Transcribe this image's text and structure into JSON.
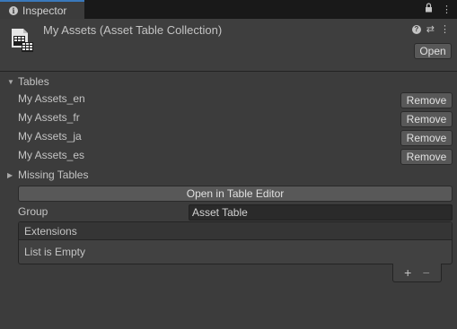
{
  "tab": {
    "title": "Inspector",
    "info_icon": "i",
    "lock_icon": "lock",
    "menu_icon": "⋮"
  },
  "header": {
    "title": "My Assets (Asset Table Collection)",
    "help_icon": "?",
    "presets_icon": "⇄",
    "menu_icon": "⋮",
    "open_label": "Open"
  },
  "tables": {
    "label": "Tables",
    "items": [
      {
        "name": "My Assets_en",
        "action": "Remove"
      },
      {
        "name": "My Assets_fr",
        "action": "Remove"
      },
      {
        "name": "My Assets_ja",
        "action": "Remove"
      },
      {
        "name": "My Assets_es",
        "action": "Remove"
      }
    ]
  },
  "missing_tables": {
    "label": "Missing Tables"
  },
  "open_editor_label": "Open in Table Editor",
  "group": {
    "label": "Group",
    "value": "Asset Table"
  },
  "extensions": {
    "label": "Extensions",
    "empty_text": "List is Empty",
    "add_icon": "+",
    "remove_icon": "−"
  },
  "colors": {
    "accent": "#3a79bb",
    "panel": "#3c3c3c",
    "button": "#585858"
  }
}
